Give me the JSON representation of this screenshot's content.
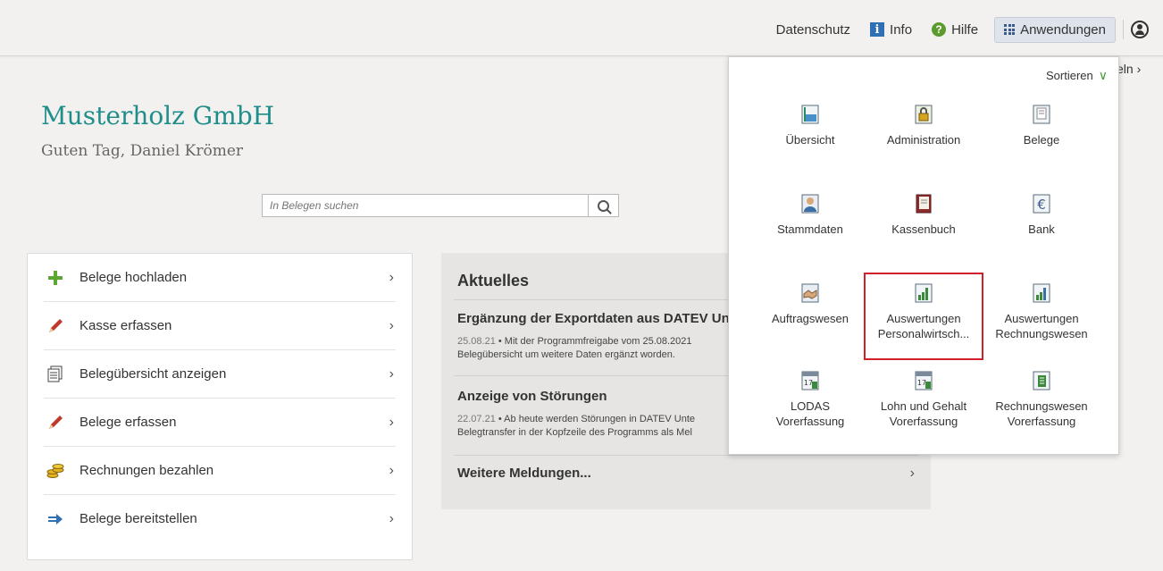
{
  "topbar": {
    "datenschutz": "Datenschutz",
    "info": "Info",
    "hilfe": "Hilfe",
    "anwendungen": "Anwendungen"
  },
  "company": {
    "name": "Musterholz GmbH",
    "greeting": "Guten Tag, Daniel Krömer"
  },
  "search": {
    "placeholder": "In Belegen suchen"
  },
  "actions": [
    {
      "label": "Belege hochladen",
      "icon": "plus-icon"
    },
    {
      "label": "Kasse erfassen",
      "icon": "pencil-icon"
    },
    {
      "label": "Belegübersicht anzeigen",
      "icon": "documents-icon"
    },
    {
      "label": "Belege erfassen",
      "icon": "pencil-icon"
    },
    {
      "label": "Rechnungen bezahlen",
      "icon": "coins-icon"
    },
    {
      "label": "Belege bereitstellen",
      "icon": "arrow-right-icon"
    }
  ],
  "news": {
    "title": "Aktuelles",
    "items": [
      {
        "title": "Ergänzung der Exportdaten aus DATEV Un",
        "date": "25.08.21",
        "line1": " • Mit der Programmfreigabe vom 25.08.2021",
        "line2": "Belegübersicht um weitere Daten ergänzt worden."
      },
      {
        "title": "Anzeige von Störungen",
        "date": "22.07.21",
        "line1": " • Ab heute werden Störungen in DATEV Unte",
        "line2": "Belegtransfer in der Kopfzeile des Programms als Mel"
      }
    ],
    "more": "Weitere Meldungen..."
  },
  "partial_text": "eln",
  "apps_panel": {
    "sort_label": "Sortieren",
    "apps": [
      {
        "line1": "Übersicht",
        "line2": "",
        "icon": "overview-icon"
      },
      {
        "line1": "Administration",
        "line2": "",
        "icon": "lock-icon"
      },
      {
        "line1": "Belege",
        "line2": "",
        "icon": "receipt-icon"
      },
      {
        "line1": "Stammdaten",
        "line2": "",
        "icon": "person-icon"
      },
      {
        "line1": "Kassenbuch",
        "line2": "",
        "icon": "book-icon"
      },
      {
        "line1": "Bank",
        "line2": "",
        "icon": "euro-icon"
      },
      {
        "line1": "Auftragswesen",
        "line2": "",
        "icon": "handshake-icon"
      },
      {
        "line1": "Auswertungen",
        "line2": "Personalwirtsch...",
        "icon": "chart-icon"
      },
      {
        "line1": "Auswertungen",
        "line2": "Rechnungswesen",
        "icon": "chart-icon"
      },
      {
        "line1": "LODAS",
        "line2": "Vorerfassung",
        "icon": "calendar-icon"
      },
      {
        "line1": "Lohn und Gehalt",
        "line2": "Vorerfassung",
        "icon": "calendar-icon"
      },
      {
        "line1": "Rechnungswesen",
        "line2": "Vorerfassung",
        "icon": "ledger-icon"
      }
    ]
  },
  "colors": {
    "brand_teal": "#1f8e8b",
    "highlight_red": "#d0202a",
    "accent_green": "#4a9a3b"
  }
}
